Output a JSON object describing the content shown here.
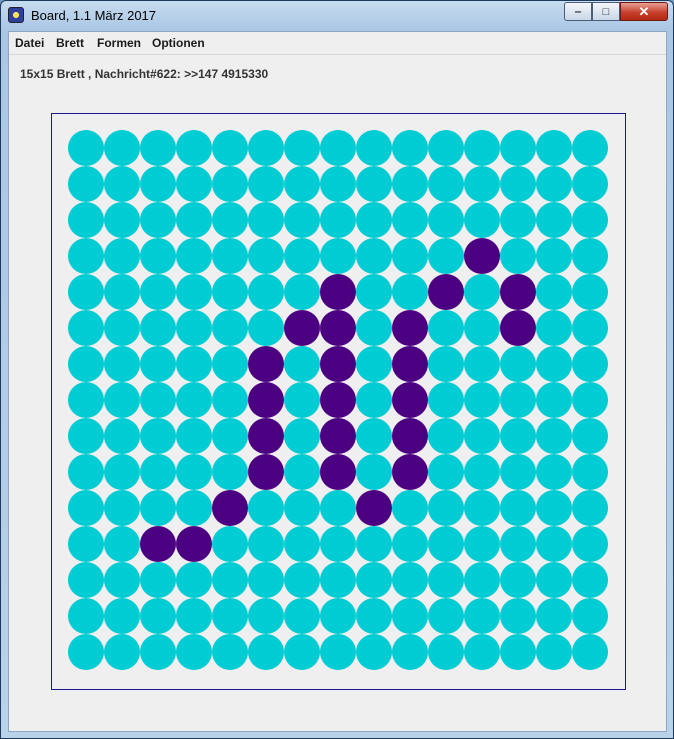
{
  "window": {
    "title": "Board, 1.1 März 2017",
    "minimize_glyph": "‒",
    "maximize_glyph": "□",
    "close_glyph": "✕"
  },
  "menu": [
    "Datei",
    "Brett",
    "Formen",
    "Optionen"
  ],
  "status_text": "15x15 Brett , Nachricht#622: >>147 4915330",
  "board": {
    "size": 15,
    "colors": {
      "empty": "#00ccd4",
      "filled": "#4b0082",
      "border": "#1a1a8a"
    },
    "filled": [
      [
        3,
        11
      ],
      [
        4,
        7
      ],
      [
        4,
        10
      ],
      [
        4,
        12
      ],
      [
        5,
        6
      ],
      [
        5,
        7
      ],
      [
        5,
        9
      ],
      [
        5,
        12
      ],
      [
        6,
        5
      ],
      [
        6,
        7
      ],
      [
        6,
        9
      ],
      [
        7,
        5
      ],
      [
        7,
        7
      ],
      [
        7,
        9
      ],
      [
        8,
        5
      ],
      [
        8,
        7
      ],
      [
        8,
        9
      ],
      [
        9,
        5
      ],
      [
        9,
        7
      ],
      [
        9,
        9
      ],
      [
        10,
        4
      ],
      [
        10,
        8
      ],
      [
        11,
        2
      ],
      [
        11,
        3
      ]
    ]
  }
}
